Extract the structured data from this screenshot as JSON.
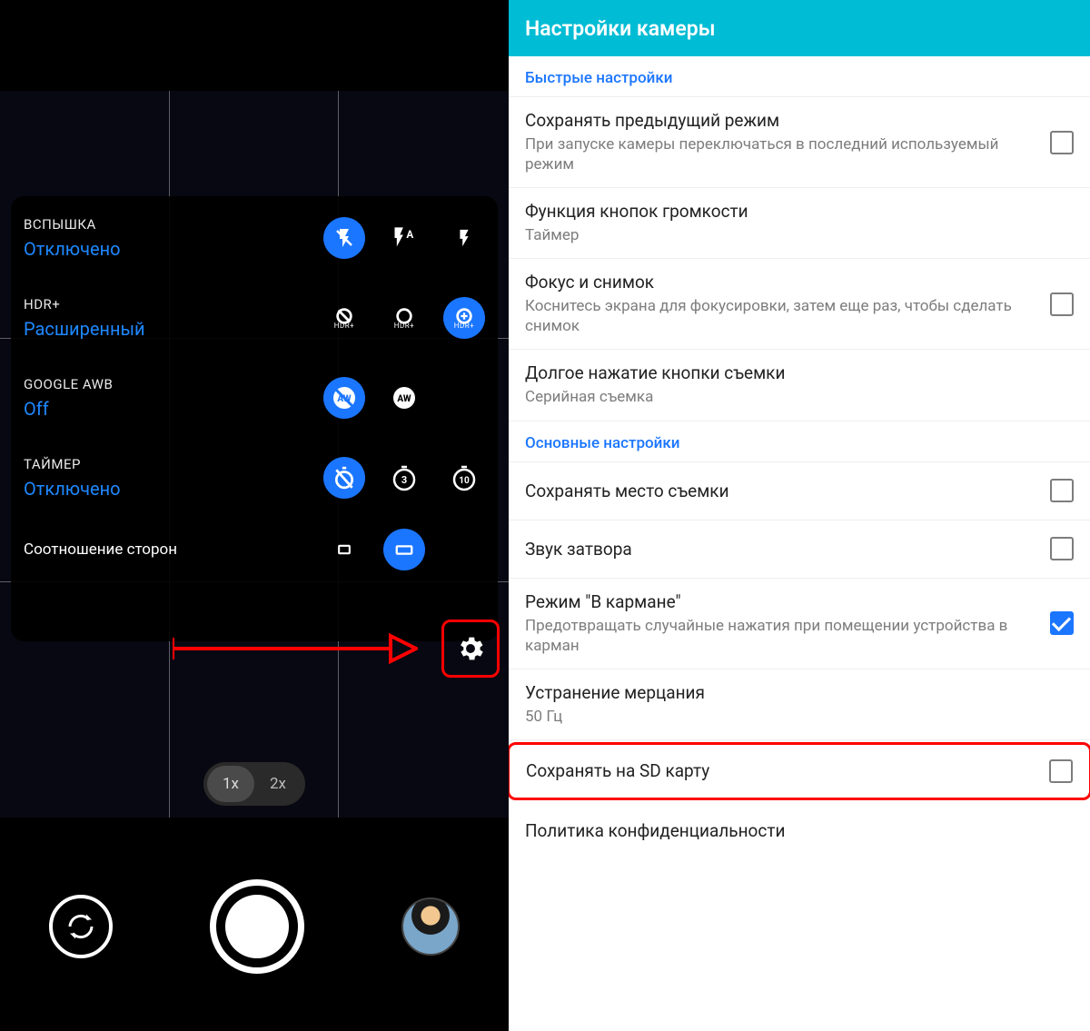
{
  "left": {
    "rows": [
      {
        "label": "ВСПЫШКА",
        "value": "Отключено"
      },
      {
        "label": "HDR+",
        "value": "Расширенный"
      },
      {
        "label": "GOOGLE AWB",
        "value": "Off"
      },
      {
        "label": "ТАЙМЕР",
        "value": "Отключено"
      }
    ],
    "aspect_label": "Соотношение сторон",
    "zoom": {
      "a": "1x",
      "b": "2x"
    },
    "timer_opts": {
      "b": "3",
      "c": "10"
    },
    "hdr_sub": "HDR+"
  },
  "right": {
    "header": "Настройки камеры",
    "section_quick": "Быстрые настройки",
    "section_main": "Основные настройки",
    "items": [
      {
        "title": "Сохранять предыдущий режим",
        "desc": "При запуске камеры переключаться в последний используемый режим"
      },
      {
        "title": "Функция кнопок громкости",
        "desc": "Таймер"
      },
      {
        "title": "Фокус и снимок",
        "desc": "Коснитесь экрана для фокусировки, затем еще раз, чтобы сделать снимок"
      },
      {
        "title": "Долгое нажатие кнопки съемки",
        "desc": "Серийная съемка"
      },
      {
        "title": "Сохранять место съемки",
        "desc": ""
      },
      {
        "title": "Звук затвора",
        "desc": ""
      },
      {
        "title": "Режим \"В кармане\"",
        "desc": "Предотвращать случайные нажатия при помещении устройства в карман"
      },
      {
        "title": "Устранение мерцания",
        "desc": "50 Гц"
      },
      {
        "title": "Сохранять на SD карту",
        "desc": ""
      },
      {
        "title": "Политика конфиденциальности",
        "desc": ""
      }
    ]
  }
}
